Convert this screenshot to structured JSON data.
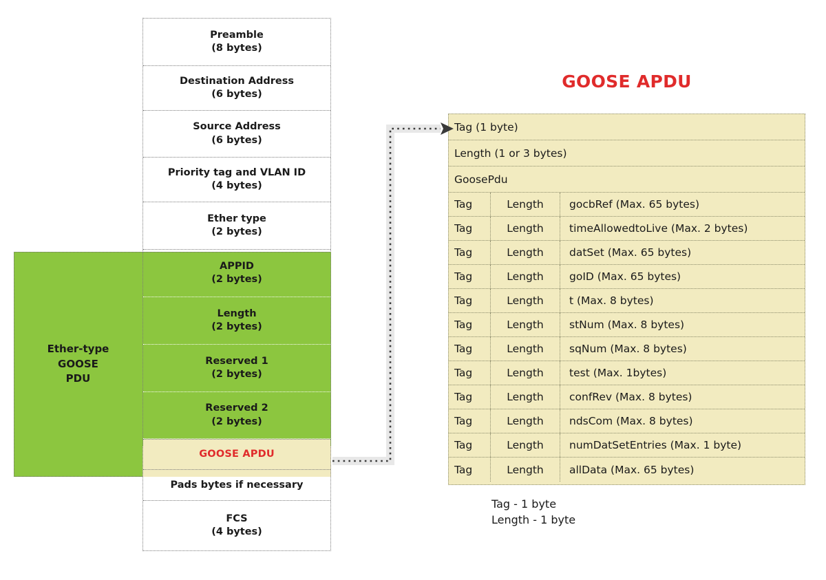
{
  "colors": {
    "green_pdu": "#8CC63F",
    "cream_apdu": "#F2EBC0",
    "accent_red": "#E02B2B",
    "text": "#1A1A1A",
    "dotted_border": "#7A7A7A"
  },
  "ethernet_frame": {
    "rows": [
      {
        "name": "Preamble",
        "size": "(8 bytes)",
        "fill": "white"
      },
      {
        "name": "Destination Address",
        "size": "(6 bytes)",
        "fill": "white"
      },
      {
        "name": "Source Address",
        "size": "(6 bytes)",
        "fill": "white"
      },
      {
        "name": "Priority tag and VLAN ID",
        "size": "(4 bytes)",
        "fill": "white"
      },
      {
        "name": "Ether type",
        "size": "(2 bytes)",
        "fill": "white"
      },
      {
        "name": "APPID",
        "size": "(2 bytes)",
        "fill": "green"
      },
      {
        "name": "Length",
        "size": "(2 bytes)",
        "fill": "green"
      },
      {
        "name": "Reserved 1",
        "size": "(2 bytes)",
        "fill": "green"
      },
      {
        "name": "Reserved 2",
        "size": "(2 bytes)",
        "fill": "green"
      },
      {
        "name": "GOOSE APDU",
        "size": "",
        "fill": "cream"
      },
      {
        "name": "Pads bytes if necessary",
        "size": "",
        "fill": "white"
      },
      {
        "name": "FCS",
        "size": "(4 bytes)",
        "fill": "white"
      }
    ]
  },
  "pdu_block": {
    "label_line1": "Ether-type",
    "label_line2": "GOOSE",
    "label_line3": "PDU"
  },
  "apdu": {
    "title": "GOOSE APDU",
    "header_rows": [
      {
        "text": "Tag (1 byte)"
      },
      {
        "text": "Length (1 or 3 bytes)"
      },
      {
        "text": "GoosePdu"
      }
    ],
    "tag_label": "Tag",
    "length_label": "Length",
    "fields": [
      {
        "tag": "Tag",
        "length": "Length",
        "desc": "gocbRef (Max. 65 bytes)"
      },
      {
        "tag": "Tag",
        "length": "Length",
        "desc": "timeAllowedtoLive (Max. 2 bytes)"
      },
      {
        "tag": "Tag",
        "length": "Length",
        "desc": "datSet (Max. 65 bytes)"
      },
      {
        "tag": "Tag",
        "length": "Length",
        "desc": "goID (Max. 65 bytes)"
      },
      {
        "tag": "Tag",
        "length": "Length",
        "desc": "t (Max. 8 bytes)"
      },
      {
        "tag": "Tag",
        "length": "Length",
        "desc": "stNum (Max. 8 bytes)"
      },
      {
        "tag": "Tag",
        "length": "Length",
        "desc": "sqNum (Max. 8 bytes)"
      },
      {
        "tag": "Tag",
        "length": "Length",
        "desc": "test (Max. 1bytes)"
      },
      {
        "tag": "Tag",
        "length": "Length",
        "desc": "confRev (Max. 8 bytes)"
      },
      {
        "tag": "Tag",
        "length": "Length",
        "desc": "ndsCom (Max. 8 bytes)"
      },
      {
        "tag": "Tag",
        "length": "Length",
        "desc": "numDatSetEntries (Max. 1 byte)"
      },
      {
        "tag": "Tag",
        "length": "Length",
        "desc": "allData (Max. 65 bytes)"
      }
    ],
    "legend_line1": "Tag - 1 byte",
    "legend_line2": "Length - 1 byte"
  }
}
